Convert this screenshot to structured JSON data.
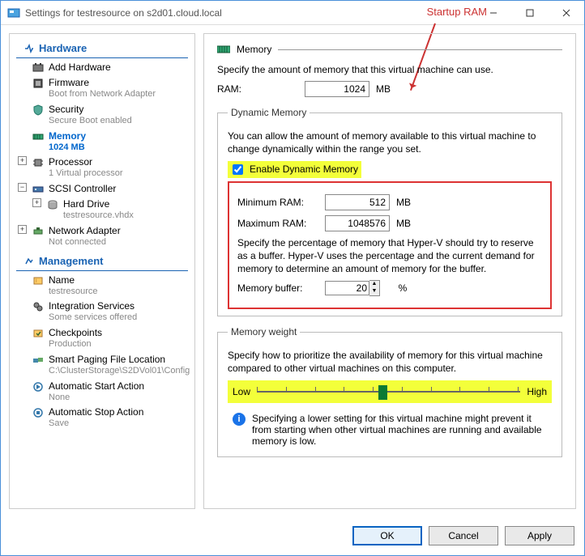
{
  "window": {
    "title": "Settings for testresource on s2d01.cloud.local",
    "annotation_startup": "Startup RAM"
  },
  "nav": {
    "hardware_header": "Hardware",
    "management_header": "Management",
    "add_hardware": "Add Hardware",
    "firmware": {
      "label": "Firmware",
      "sub": "Boot from Network Adapter"
    },
    "security": {
      "label": "Security",
      "sub": "Secure Boot enabled"
    },
    "memory": {
      "label": "Memory",
      "sub": "1024 MB"
    },
    "processor": {
      "label": "Processor",
      "sub": "1 Virtual processor"
    },
    "scsi": {
      "label": "SCSI Controller"
    },
    "hard_drive": {
      "label": "Hard Drive",
      "sub": "testresource.vhdx"
    },
    "net_adapter": {
      "label": "Network Adapter",
      "sub": "Not connected"
    },
    "name": {
      "label": "Name",
      "sub": "testresource"
    },
    "int_services": {
      "label": "Integration Services",
      "sub": "Some services offered"
    },
    "checkpoints": {
      "label": "Checkpoints",
      "sub": "Production"
    },
    "smart_paging": {
      "label": "Smart Paging File Location",
      "sub": "C:\\ClusterStorage\\S2DVol01\\Config"
    },
    "auto_start": {
      "label": "Automatic Start Action",
      "sub": "None"
    },
    "auto_stop": {
      "label": "Automatic Stop Action",
      "sub": "Save"
    }
  },
  "pane": {
    "header": "Memory",
    "intro": "Specify the amount of memory that this virtual machine can use.",
    "ram_label": "RAM:",
    "ram_value": "1024",
    "ram_unit": "MB",
    "dyn_group": "Dynamic Memory",
    "dyn_intro": "You can allow the amount of memory available to this virtual machine to change dynamically within the range you set.",
    "dyn_chk": "Enable Dynamic Memory",
    "dyn_checked": true,
    "min_label": "Minimum RAM:",
    "min_value": "512",
    "min_unit": "MB",
    "max_label": "Maximum RAM:",
    "max_value": "1048576",
    "max_unit": "MB",
    "buffer_intro": "Specify the percentage of memory that Hyper-V should try to reserve as a buffer. Hyper-V uses the percentage and the current demand for memory to determine an amount of memory for the buffer.",
    "buffer_label": "Memory buffer:",
    "buffer_value": "20",
    "buffer_unit": "%",
    "weight_group": "Memory weight",
    "weight_intro": "Specify how to prioritize the availability of memory for this virtual machine compared to other virtual machines on this computer.",
    "weight_low": "Low",
    "weight_high": "High",
    "weight_info": "Specifying a lower setting for this virtual machine might prevent it from starting when other virtual machines are running and available memory is low."
  },
  "buttons": {
    "ok": "OK",
    "cancel": "Cancel",
    "apply": "Apply"
  }
}
